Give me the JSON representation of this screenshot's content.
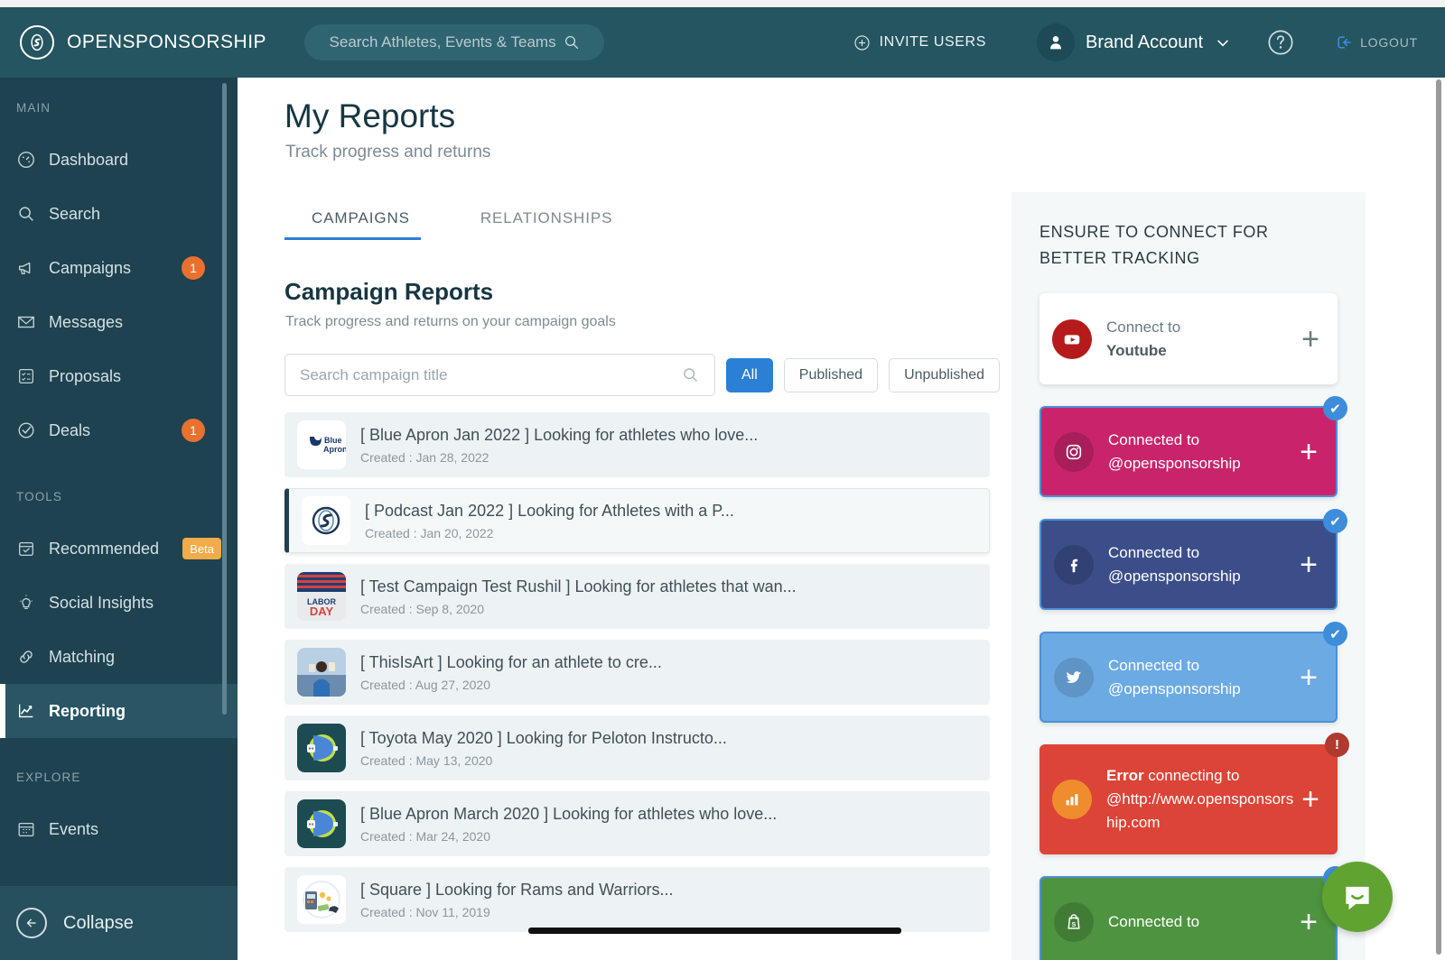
{
  "header": {
    "brand": "OPENSPONSORSHIP",
    "search_placeholder": "Search Athletes, Events & Teams",
    "invite_label": "INVITE USERS",
    "account_label": "Brand Account",
    "logout_label": "LOGOUT"
  },
  "sidebar": {
    "sections": [
      {
        "label": "MAIN",
        "items": [
          {
            "label": "Dashboard",
            "icon": "dashboard-icon",
            "badge": null
          },
          {
            "label": "Search",
            "icon": "search-icon",
            "badge": null
          },
          {
            "label": "Campaigns",
            "icon": "megaphone-icon",
            "badge": "1"
          },
          {
            "label": "Messages",
            "icon": "envelope-icon",
            "badge": null
          },
          {
            "label": "Proposals",
            "icon": "list-icon",
            "badge": null
          },
          {
            "label": "Deals",
            "icon": "check-circle-icon",
            "badge": "1"
          }
        ]
      },
      {
        "label": "TOOLS",
        "items": [
          {
            "label": "Recommended",
            "icon": "box-check-icon",
            "badge": "Beta"
          },
          {
            "label": "Social Insights",
            "icon": "bulb-icon",
            "badge": null
          },
          {
            "label": "Matching",
            "icon": "link-icon",
            "badge": null
          },
          {
            "label": "Reporting",
            "icon": "chart-line-icon",
            "badge": null,
            "active": true
          }
        ]
      },
      {
        "label": "EXPLORE",
        "items": [
          {
            "label": "Events",
            "icon": "calendar-icon",
            "badge": null
          }
        ]
      }
    ],
    "collapse_label": "Collapse"
  },
  "main": {
    "title": "My Reports",
    "subtitle": "Track progress and returns",
    "tabs": [
      {
        "label": "CAMPAIGNS",
        "active": true
      },
      {
        "label": "RELATIONSHIPS",
        "active": false
      }
    ],
    "section_title": "Campaign Reports",
    "section_subtitle": "Track progress and returns on your campaign goals",
    "search_placeholder": "Search campaign title",
    "search_value": "",
    "filters": [
      {
        "label": "All",
        "active": true
      },
      {
        "label": "Published",
        "active": false
      },
      {
        "label": "Unpublished",
        "active": false
      }
    ],
    "created_prefix": "Created : ",
    "rows": [
      {
        "title": "[ Blue Apron Jan 2022 ] Looking for athletes who love...",
        "created": "Jan 28, 2022",
        "thumb": "blue-apron",
        "selected": false
      },
      {
        "title": "[ Podcast Jan 2022 ] Looking for Athletes with a P...",
        "created": "Jan 20, 2022",
        "thumb": "opensponsorship",
        "selected": true
      },
      {
        "title": "[ Test Campaign Test Rushil ] Looking for athletes that wan...",
        "created": "Sep 8, 2020",
        "thumb": "labor-day",
        "selected": false
      },
      {
        "title": "[ ThisIsArt ] Looking for an athlete to cre...",
        "created": "Aug 27, 2020",
        "thumb": "athlete-photo",
        "selected": false
      },
      {
        "title": "[ Toyota May 2020 ] Looking for Peloton Instructo...",
        "created": "May 13, 2020",
        "thumb": "toyota",
        "selected": false
      },
      {
        "title": "[ Blue Apron March 2020 ] Looking for athletes who love...",
        "created": "Mar 24, 2020",
        "thumb": "toyota",
        "selected": false
      },
      {
        "title": "[ Square ] Looking for Rams and Warriors...",
        "created": "Nov 11, 2019",
        "thumb": "square",
        "selected": false
      }
    ]
  },
  "right_panel": {
    "title": "ENSURE TO CONNECT FOR BETTER TRACKING",
    "plus_label": "+",
    "check_glyph": "✔",
    "error_glyph": "!",
    "cards": [
      {
        "icon": "youtube-icon",
        "line1": "Connect to",
        "line2": "Youtube",
        "state": "disconnected",
        "bg": "#ffffff",
        "fg": "#6b7a81",
        "icon_bg": "#b51b1b"
      },
      {
        "icon": "instagram-icon",
        "line1": "Connected to",
        "line2": "@opensponsorship",
        "state": "connected",
        "bg": "#c9246b",
        "fg": "#ffffff",
        "icon_bg": "rgba(0,0,0,0.16)"
      },
      {
        "icon": "facebook-icon",
        "line1": "Connected to",
        "line2": "@opensponsorship",
        "state": "connected",
        "bg": "#3c4e8a",
        "fg": "#ffffff",
        "icon_bg": "rgba(0,0,0,0.16)"
      },
      {
        "icon": "twitter-icon",
        "line1": "Connected to",
        "line2": "@opensponsorship",
        "state": "connected",
        "bg": "#6caae4",
        "fg": "#ffffff",
        "icon_bg": "rgba(0,0,0,0.13)"
      },
      {
        "icon": "analytics-icon",
        "line1": "Error",
        "line1b": " connecting to",
        "line2": "@http://www.opensponsorship.com",
        "state": "error",
        "bg": "#dc4437",
        "fg": "#ffffff",
        "icon_bg": "#ef8c2e"
      },
      {
        "icon": "shopify-icon",
        "line1": "Connected to",
        "line2": "",
        "state": "connected",
        "bg": "#4e9440",
        "fg": "#ffffff",
        "icon_bg": "rgba(0,0,0,0.16)"
      }
    ]
  },
  "chat": {
    "icon": "intercom-chat-icon",
    "color": "#61a330"
  }
}
